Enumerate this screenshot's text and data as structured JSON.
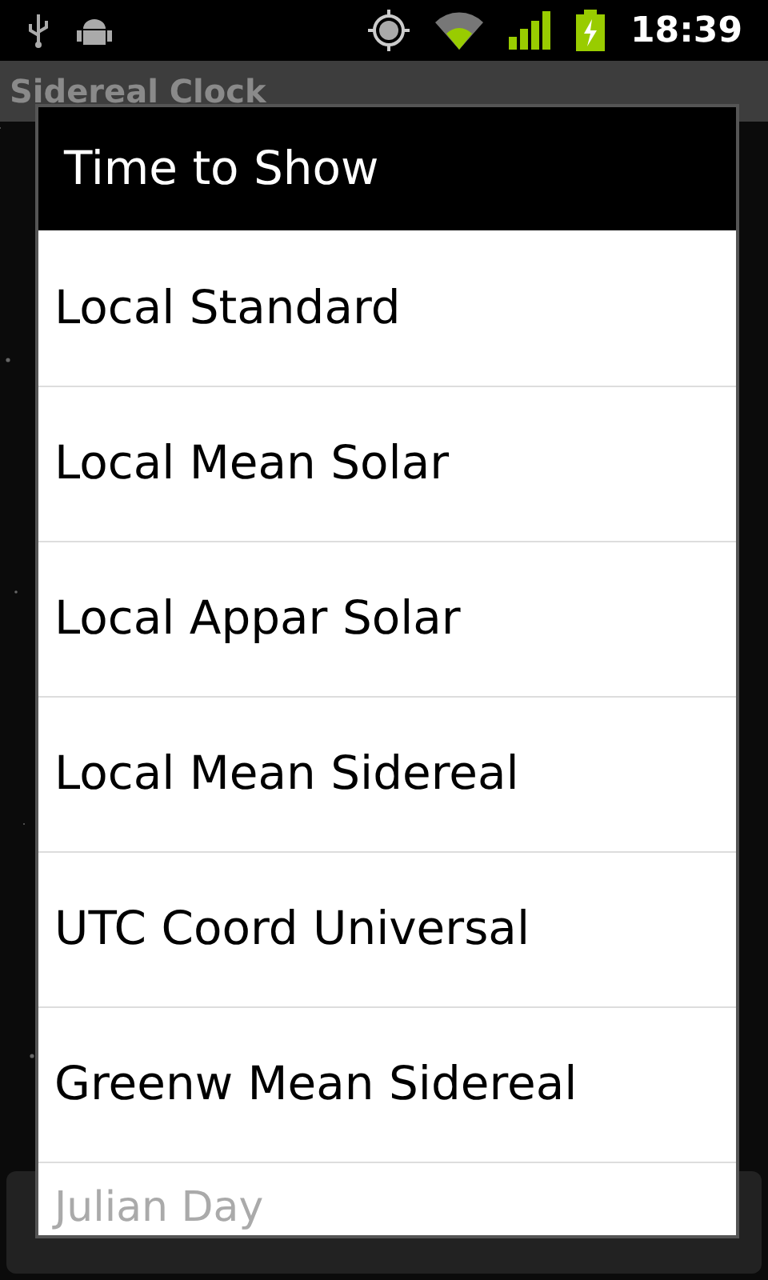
{
  "status_bar": {
    "time": "18:39"
  },
  "app_bar": {
    "title": "Sidereal Clock"
  },
  "dialog": {
    "title": "Time to Show",
    "items": [
      {
        "label": "Local Standard"
      },
      {
        "label": "Local Mean Solar"
      },
      {
        "label": "Local Appar Solar"
      },
      {
        "label": "Local Mean Sidereal"
      },
      {
        "label": "UTC Coord Universal"
      },
      {
        "label": "Greenw Mean Sidereal"
      },
      {
        "label": "Julian Day"
      }
    ]
  }
}
